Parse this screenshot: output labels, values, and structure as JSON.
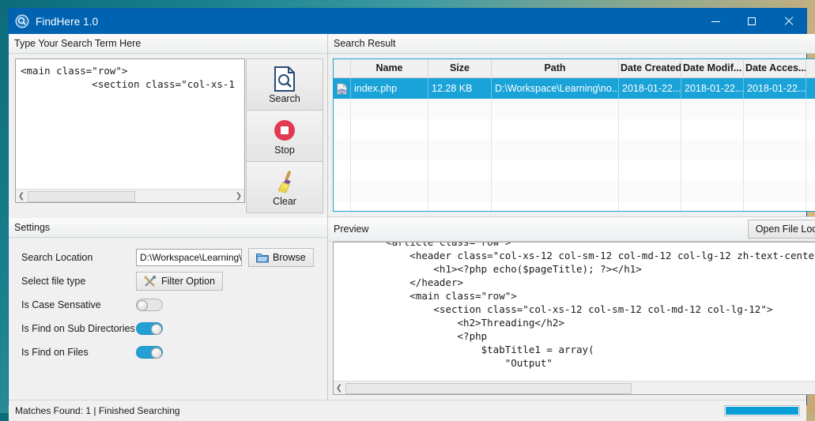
{
  "window": {
    "title": "FindHere 1.0",
    "icon": "magnifier-circle-icon",
    "controls": {
      "minimize": "minimize-icon",
      "maximize": "maximize-icon",
      "close": "close-icon"
    }
  },
  "search_panel": {
    "header": "Type Your Search Term Here",
    "term_text": "<main class=\"row\">\n            <section class=\"col-xs-1",
    "buttons": [
      {
        "label": "Search",
        "icon": "document-search-icon"
      },
      {
        "label": "Stop",
        "icon": "stop-circle-icon"
      },
      {
        "label": "Clear",
        "icon": "broom-icon"
      }
    ]
  },
  "settings": {
    "header": "Settings",
    "search_location_label": "Search Location",
    "search_location_value": "D:\\Workspace\\Learning\\",
    "browse_label": "Browse",
    "browse_icon": "folder-icon",
    "file_type_label": "Select file type",
    "filter_label": "Filter Option",
    "filter_icon": "tools-icon",
    "toggles": [
      {
        "label": "Is Case Sensative",
        "state": "off"
      },
      {
        "label": "Is Find on Sub Directories",
        "state": "on"
      },
      {
        "label": "Is Find on Files",
        "state": "on"
      }
    ]
  },
  "results": {
    "header": "Search Result",
    "columns": [
      "",
      "Name",
      "Size",
      "Path",
      "Date Created",
      "Date Modif...",
      "Date Acces...",
      ""
    ],
    "rows": [
      {
        "icon": "php-file-icon",
        "name": "index.php",
        "size": "12.28 KB",
        "path": "D:\\Workspace\\Learning\\no...",
        "date_created": "2018-01-22...",
        "date_modified": "2018-01-22...",
        "date_accessed": "2018-01-22...",
        "selected": true
      }
    ],
    "empty_row_count": 6
  },
  "preview": {
    "header": "Preview",
    "open_file_location_label": "Open File Location",
    "code": "        <article class=\"row\">\n            <header class=\"col-xs-12 col-sm-12 col-md-12 col-lg-12 zh-text-center\">\n                <h1><?php echo($pageTitle); ?></h1>\n            </header>\n            <main class=\"row\">\n                <section class=\"col-xs-12 col-sm-12 col-md-12 col-lg-12\">\n                    <h2>Threading</h2>\n                    <?php\n                        $tabTitle1 = array(\n                            \"Output\""
  },
  "statusbar": {
    "message": "Matches Found: 1 | Finished Searching",
    "progress_percent": 100
  },
  "colors": {
    "title_bar": "#0063b1",
    "accent": "#1aa3d8",
    "toggle_on": "#24a0d6",
    "progress": "#0a9ed8"
  }
}
